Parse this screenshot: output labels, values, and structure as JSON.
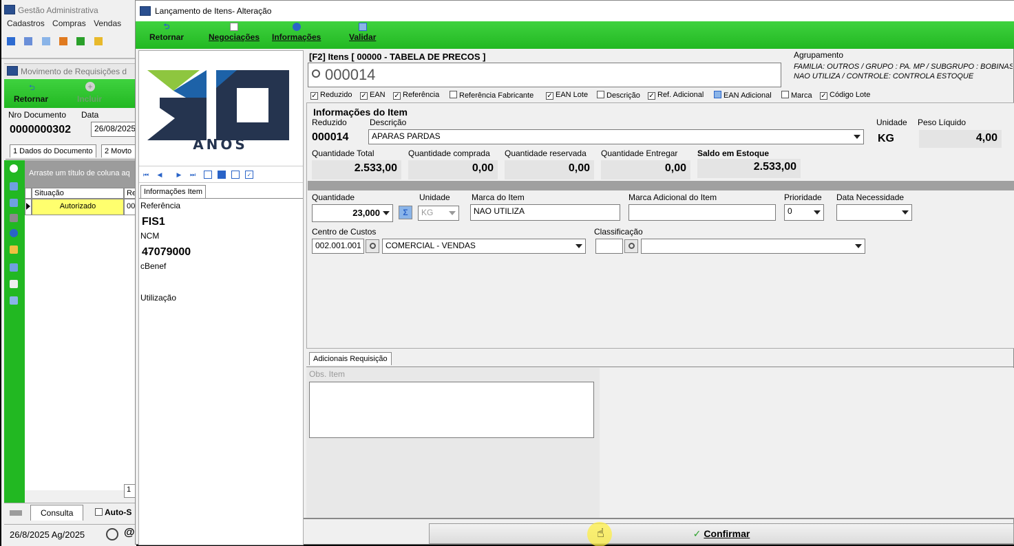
{
  "bg_window": {
    "title": "Gestão Administrativa",
    "menu": [
      "Cadastros",
      "Compras",
      "Vendas"
    ],
    "mdi_title": "Movimento de Requisições d",
    "toolbar": {
      "retornar": "Retornar",
      "incluir": "Incluir"
    },
    "fields": {
      "nro_label": "Nro Documento",
      "nro_value": "0000000302",
      "data_label": "Data",
      "data_value": "26/08/2025"
    },
    "tabs": [
      "1 Dados do Documento",
      "2 Movto"
    ],
    "grid_hint": "Arraste um título de coluna aq",
    "grid_header": [
      "Situação",
      "Re"
    ],
    "grid_row": {
      "situacao": "Autorizado",
      "ref": "00"
    },
    "page_num": "1",
    "bottom_tabs": {
      "consulta": "Consulta",
      "auto": "Auto-S"
    },
    "status": "26/8/2025 Ag/2025"
  },
  "dialog": {
    "title": "Lançamento de Itens- Alteração",
    "toolbar": {
      "retornar": "Retornar",
      "negociacoes": "Negociações",
      "informacoes": "Informações",
      "validar": "Validar"
    },
    "logo_text": "ANOS",
    "left_tab": "Informações Item",
    "left_info": {
      "referencia_label": "Referência",
      "referencia": "FIS1",
      "ncm_label": "NCM",
      "ncm": "47079000",
      "cbenef_label": "cBenef",
      "utilizacao_label": "Utilização"
    },
    "search": {
      "header": "[F2] Itens [ 00000 - TABELA DE PRECOS ]",
      "value": "000014",
      "agrupamento_label": "Agrupamento",
      "agrupamento_line1": "FAMILIA: OUTROS / GRUPO : PA. MP / SUBGRUPO : BOBINAS",
      "agrupamento_line2": "NAO UTILIZA / CONTROLE: CONTROLA ESTOQUE",
      "checks": [
        {
          "label": "Reduzido",
          "checked": true
        },
        {
          "label": "EAN",
          "checked": true
        },
        {
          "label": "Referência",
          "checked": true
        },
        {
          "label": "Referência Fabricante",
          "checked": false
        },
        {
          "label": "EAN Lote",
          "checked": true
        },
        {
          "label": "Descrição",
          "checked": false
        },
        {
          "label": "Ref. Adicional",
          "checked": true
        },
        {
          "label": "EAN Adicional",
          "checked": false
        },
        {
          "label": "Marca",
          "checked": false
        },
        {
          "label": "Código Lote",
          "checked": true
        }
      ]
    },
    "item": {
      "section_title": "Informações do Item",
      "reduzido_label": "Reduzido",
      "reduzido": "000014",
      "descricao_label": "Descrição",
      "descricao": "APARAS PARDAS",
      "unidade_label": "Unidade",
      "unidade": "KG",
      "peso_label": "Peso Líquido",
      "peso": "4,00",
      "qtd_total_label": "Quantidade Total",
      "qtd_total": "2.533,00",
      "qtd_comprada_label": "Quantidade comprada",
      "qtd_comprada": "0,00",
      "qtd_reservada_label": "Quantidade reservada",
      "qtd_reservada": "0,00",
      "qtd_entregar_label": "Quantidade Entregar",
      "qtd_entregar": "0,00",
      "saldo_label": "Saldo em Estoque",
      "saldo": "2.533,00"
    },
    "form": {
      "quantidade_label": "Quantidade",
      "quantidade": "23,000",
      "unidade_label": "Unidade",
      "unidade": "KG",
      "marca_label": "Marca do Item",
      "marca": "NAO UTILIZA",
      "marca_adic_label": "Marca Adicional do Item",
      "marca_adic": "",
      "prioridade_label": "Prioridade",
      "prioridade": "0",
      "data_nec_label": "Data Necessidade",
      "data_nec": "",
      "centro_label": "Centro de Custos",
      "centro_code": "002.001.001",
      "centro_desc": "COMERCIAL - VENDAS",
      "classif_label": "Classificação",
      "classif_code": "",
      "classif_desc": ""
    },
    "adicionais_tab": "Adicionais Requisição",
    "obs_label": "Obs. Item",
    "confirm": "Confirmar"
  }
}
